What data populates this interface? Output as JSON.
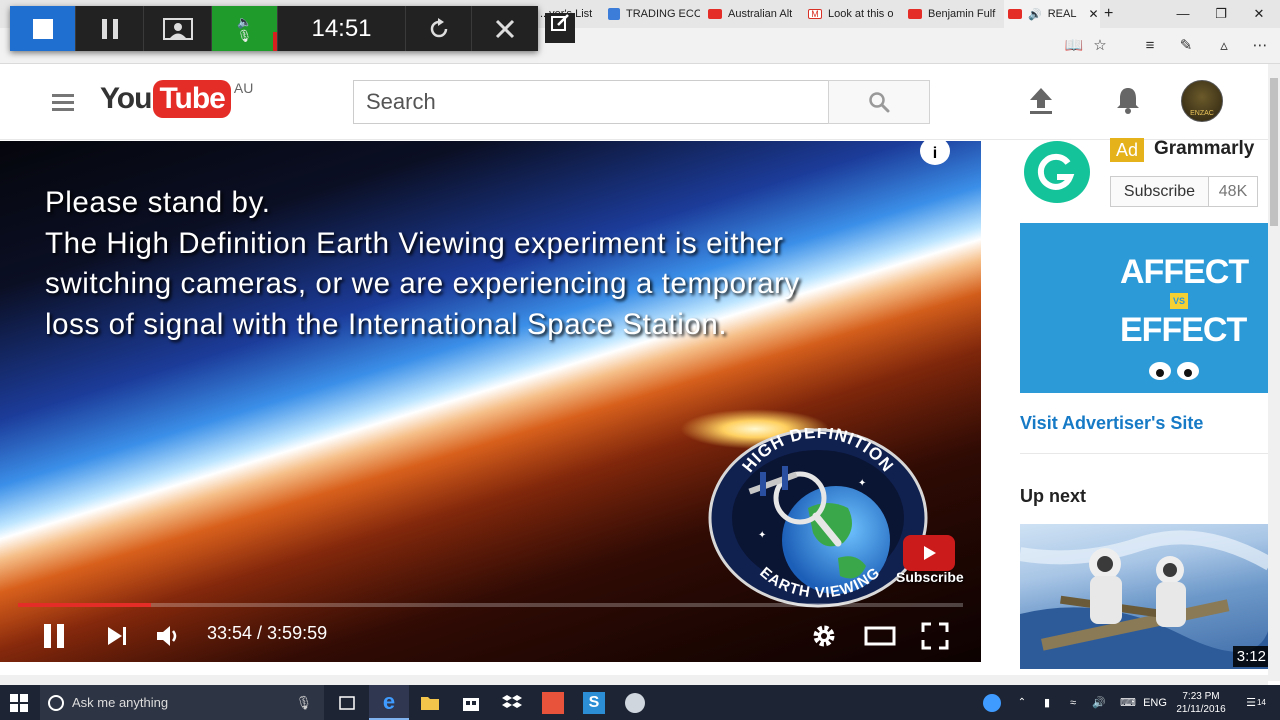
{
  "browser": {
    "tabs": [
      {
        "label": "...ver's List",
        "favicon": "generic-tab-icon",
        "color": "#777777"
      },
      {
        "label": "TRADING ECC",
        "favicon": "bar-chart-icon",
        "color": "#3b7dd8"
      },
      {
        "label": "Australian Alt",
        "favicon": "youtube-icon",
        "color": "#e52d27"
      },
      {
        "label": "Look at this o",
        "favicon": "gmail-icon",
        "color": "#d93025"
      },
      {
        "label": "Benjamin Fulf",
        "favicon": "youtube-icon",
        "color": "#e52d27"
      },
      {
        "label": "REAL",
        "favicon": "youtube-icon",
        "color": "#e52d27",
        "active": true
      }
    ],
    "window_buttons": {
      "minimize": "—",
      "restore": "❐",
      "close": "✕"
    }
  },
  "recorder": {
    "time": "14:51"
  },
  "youtube": {
    "logo_you": "You",
    "logo_tube": "Tube",
    "region": "AU",
    "search_placeholder": "Search",
    "avatar_text": "ENZAC"
  },
  "player": {
    "caption_lines": [
      "Please stand by.",
      "The High Definition Earth Viewing experiment is either",
      "switching cameras, or we are experiencing a temporary",
      "loss of signal with the International Space Station."
    ],
    "info_label": "i",
    "badge_top": "HIGH DEFINITION",
    "badge_bottom": "EARTH VIEWING",
    "subscribe_overlay": "Subscribe",
    "current_time": "33:54",
    "duration": "3:59:59",
    "time_text": "33:54 / 3:59:59",
    "progress_fraction": 0.141
  },
  "sidebar": {
    "ad": {
      "badge": "Ad",
      "name": "Grammarly",
      "subscribe_label": "Subscribe",
      "subscriber_count": "48K",
      "image_line1": "AFFECT",
      "image_vs": "VS",
      "image_line2": "EFFECT",
      "visit_link": "Visit Advertiser's Site"
    },
    "up_next": {
      "heading": "Up next",
      "duration": "3:12"
    }
  },
  "taskbar": {
    "search_placeholder": "Ask me anything",
    "language": "ENG",
    "time": "7:23 PM",
    "date": "21/11/2016",
    "notification_count": "14"
  },
  "colors": {
    "youtube_red": "#e52d27",
    "link_blue": "#167ac6",
    "recorder_stop": "#1f6fd1",
    "recorder_audio": "#1f9b2c",
    "grammarly_green": "#15c39a",
    "ad_yellow": "#e6b21b"
  }
}
